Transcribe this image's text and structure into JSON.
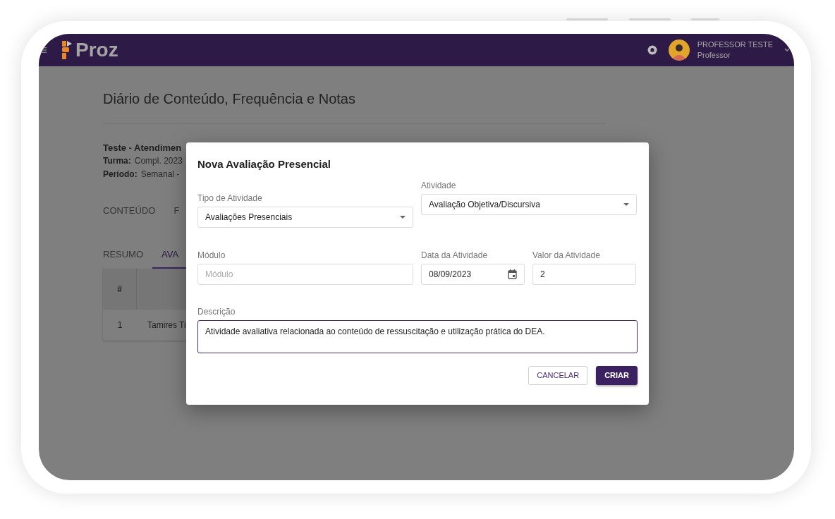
{
  "app_bar": {
    "logo": "Proz",
    "user_name": "PROFESSOR TESTE",
    "user_role": "Professor"
  },
  "page": {
    "title": "Diário de Conteúdo, Frequência e Notas",
    "course": "Teste - Atendimen",
    "details": [
      {
        "label": "Turma:",
        "value": "Compl. 2023"
      },
      {
        "label": "Período:",
        "value": "Semanal -"
      }
    ],
    "tabs": [
      {
        "label": "CONTEÚDO",
        "selected": false
      },
      {
        "label": "F",
        "selected": false
      }
    ],
    "subtabs": [
      {
        "label": "RESUMO",
        "selected": false
      },
      {
        "label": "AVA",
        "selected": true
      }
    ],
    "table": {
      "columns": [
        "#"
      ],
      "rows": [
        [
          "1",
          "Tamires Ti"
        ]
      ]
    }
  },
  "dialog": {
    "title": "Nova Avaliação Presencial",
    "fields": [
      {
        "kind": "select",
        "label": "Tipo de Atividade",
        "value": "Avaliações Presenciais",
        "focused": false
      },
      {
        "kind": "select",
        "label": "Atividade",
        "value": "Avaliação Objetiva/Discursiva",
        "focused": false
      },
      {
        "kind": "text",
        "label": "Módulo",
        "placeholder": "Módulo",
        "focused": false
      },
      {
        "kind": "date",
        "label": "Data da Atividade",
        "value": "08/09/2023",
        "focused": false
      },
      {
        "kind": "text",
        "label": "Valor da Atividade",
        "value": "2",
        "focused": false
      },
      {
        "kind": "textarea",
        "label": "Descrição",
        "value": "Atividade avaliativa relacionada ao conteúdo de ressuscitação e utilização prática do DEA.",
        "focused": true
      }
    ],
    "buttons": [
      {
        "label": "CANCELAR",
        "kind": "outlined"
      },
      {
        "label": "CRIAR",
        "kind": "contained"
      }
    ]
  }
}
